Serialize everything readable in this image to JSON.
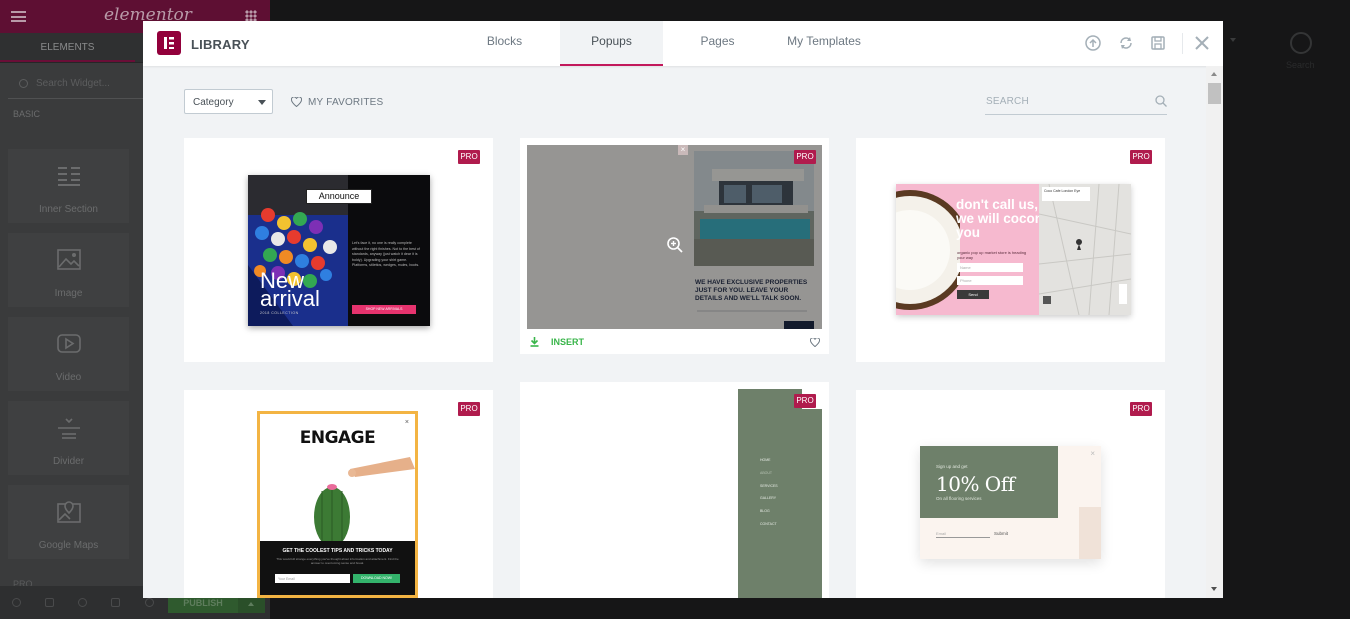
{
  "editor": {
    "logo": "elementor",
    "tabs": [
      "ELEMENTS",
      ""
    ],
    "search_placeholder": "Search Widget...",
    "section_label": "BASIC",
    "widgets": [
      {
        "label": "Inner Section",
        "icon": "inner-section-icon"
      },
      {
        "label": "Image",
        "icon": "image-icon"
      },
      {
        "label": "Video",
        "icon": "video-icon"
      },
      {
        "label": "Divider",
        "icon": "divider-icon"
      },
      {
        "label": "Google Maps",
        "icon": "map-icon"
      }
    ],
    "footer_section": "PRO",
    "publish": "PUBLISH"
  },
  "preview": {
    "search_label": "Search"
  },
  "modal": {
    "title": "LIBRARY",
    "tabs": [
      {
        "label": "Blocks",
        "active": false
      },
      {
        "label": "Popups",
        "active": true
      },
      {
        "label": "Pages",
        "active": false
      },
      {
        "label": "My Templates",
        "active": false
      }
    ],
    "header_icons": [
      "import-icon",
      "sync-icon",
      "save-icon",
      "close-icon"
    ],
    "category_select": "Category",
    "favorites_label": "MY FAVORITES",
    "search_placeholder": "SEARCH",
    "badge": "PRO",
    "insert_label": "INSERT",
    "colors": {
      "accent": "#92003b",
      "pro_badge": "#b01b4d",
      "insert": "#39b54a",
      "active_tab_border": "#c2185b"
    }
  },
  "thumbs": {
    "announce": {
      "tag": "Announce",
      "headline1": "New",
      "headline2": "arrival",
      "sub": "2018 COLLECTION",
      "body": "Let's face it, no one is really complete without the right finishes. Not to the best of standards, anyway (just watch it dear it is boldy). Upgrading your shirt game. Platforms, stilettos, wedges, mules, boots.",
      "cta": "SHOP NEW ARRIVALS"
    },
    "realestate": {
      "text": "WE HAVE EXCLUSIVE PROPERTIES JUST FOR YOU. LEAVE YOUR DETAILS AND WE'LL TALK SOON."
    },
    "coconut": {
      "headline": "don't call us, we will coconut you",
      "sub": "organic pop up market store is heading your way",
      "field1": "Name",
      "field2": "Phone",
      "button": "Send",
      "map_title": "Coco Cafe London Eye"
    },
    "engage": {
      "title": "ENGAGE",
      "band": "GET THE COOLEST TIPS AND TRICKS TODAY",
      "band_sub": "This would kill strange everything you've thought about information and attachment. Find the answer to overcoming sense and break.",
      "email": "Your Email",
      "cta": "DOWNLOAD NOW!"
    },
    "menu": {
      "items": [
        "HOME",
        "ABOUT",
        "SERVICES",
        "GALLERY",
        "BLOG",
        "CONTACT"
      ]
    },
    "offer": {
      "kicker": "Sign up and get",
      "headline": "10% Off",
      "sub": "On all flooring services",
      "email": "Email",
      "submit": "Submit"
    }
  }
}
